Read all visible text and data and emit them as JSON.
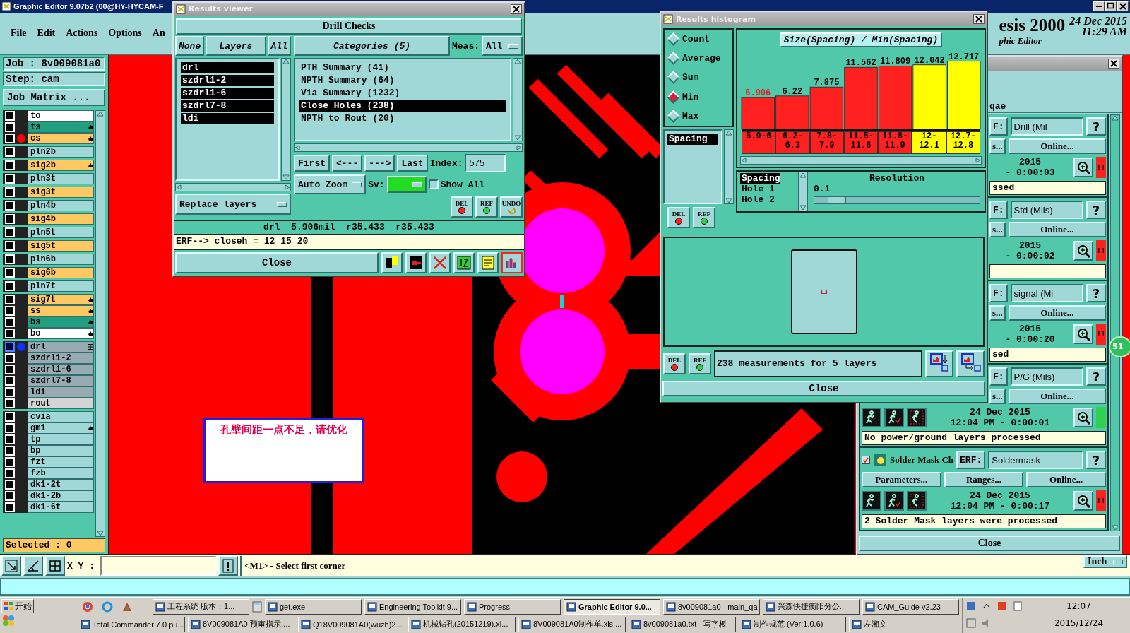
{
  "main_window": {
    "title": "Graphic Editor 9.07b2 (00@HY-HYCAM-F",
    "menu": [
      "File",
      "Edit",
      "Actions",
      "Options",
      "An"
    ]
  },
  "brand": {
    "product": "esis 2000",
    "subtitle": "phic Editor",
    "date": "24 Dec 2015",
    "time": "11:29 AM"
  },
  "layer_panel": {
    "job": "Job : 8v009081a0",
    "step": "Step: cam",
    "job_matrix": "Job Matrix ...",
    "selected": "Selected : 0",
    "groups": [
      {
        "layers": [
          {
            "name": "to",
            "color": "#ffffff",
            "checked": false,
            "displayed": false,
            "work_layer": false,
            "kind": "plain"
          },
          {
            "name": "ts",
            "color": "#20a080",
            "checked": false,
            "displayed": false,
            "work_layer": false,
            "kind": "pointer"
          },
          {
            "name": "cs",
            "color": "#ffc860",
            "checked": false,
            "displayed": true,
            "work_layer": false,
            "kind": "pointer"
          }
        ]
      },
      {
        "layers": [
          {
            "name": "pln2b",
            "color": "#a0d8d8",
            "checked": false,
            "displayed": false,
            "work_layer": false,
            "kind": "plain"
          }
        ]
      },
      {
        "layers": [
          {
            "name": "sig2b",
            "color": "#ffc860",
            "checked": false,
            "displayed": false,
            "work_layer": false,
            "kind": "pointer"
          }
        ]
      },
      {
        "layers": [
          {
            "name": "pln3t",
            "color": "#a0d8d8",
            "checked": false,
            "displayed": false,
            "work_layer": false,
            "kind": "plain"
          }
        ]
      },
      {
        "layers": [
          {
            "name": "sig3t",
            "color": "#ffc860",
            "checked": false,
            "displayed": false,
            "work_layer": false,
            "kind": "plain"
          }
        ]
      },
      {
        "layers": [
          {
            "name": "pln4b",
            "color": "#a0d8d8",
            "checked": false,
            "displayed": false,
            "work_layer": false,
            "kind": "plain"
          }
        ]
      },
      {
        "layers": [
          {
            "name": "sig4b",
            "color": "#ffc860",
            "checked": false,
            "displayed": false,
            "work_layer": false,
            "kind": "plain"
          }
        ]
      },
      {
        "layers": [
          {
            "name": "pln5t",
            "color": "#a0d8d8",
            "checked": false,
            "displayed": false,
            "work_layer": false,
            "kind": "plain"
          }
        ]
      },
      {
        "layers": [
          {
            "name": "sig5t",
            "color": "#ffc860",
            "checked": false,
            "displayed": false,
            "work_layer": false,
            "kind": "plain"
          }
        ]
      },
      {
        "layers": [
          {
            "name": "pln6b",
            "color": "#a0d8d8",
            "checked": false,
            "displayed": false,
            "work_layer": false,
            "kind": "plain"
          }
        ]
      },
      {
        "layers": [
          {
            "name": "sig6b",
            "color": "#ffc860",
            "checked": false,
            "displayed": false,
            "work_layer": false,
            "kind": "plain"
          }
        ]
      },
      {
        "layers": [
          {
            "name": "pln7t",
            "color": "#a0d8d8",
            "checked": false,
            "displayed": false,
            "work_layer": false,
            "kind": "plain"
          }
        ]
      },
      {
        "layers": [
          {
            "name": "sig7t",
            "color": "#ffc860",
            "checked": false,
            "displayed": false,
            "work_layer": false,
            "kind": "pointer"
          },
          {
            "name": "ss",
            "color": "#ffc860",
            "checked": false,
            "displayed": false,
            "work_layer": false,
            "kind": "pointer"
          },
          {
            "name": "bs",
            "color": "#20a080",
            "checked": false,
            "displayed": false,
            "work_layer": false,
            "kind": "pointer"
          },
          {
            "name": "bo",
            "color": "#ffffff",
            "checked": false,
            "displayed": false,
            "work_layer": false,
            "kind": "pointer"
          }
        ]
      },
      {
        "layers": [
          {
            "name": "drl",
            "color": "#98aab2",
            "checked": false,
            "displayed": false,
            "work_layer": true,
            "kind": "grid"
          },
          {
            "name": "szdrl1-2",
            "color": "#98aab2",
            "checked": false,
            "displayed": false,
            "work_layer": false,
            "kind": "plain"
          },
          {
            "name": "szdrl1-6",
            "color": "#98aab2",
            "checked": false,
            "displayed": false,
            "work_layer": false,
            "kind": "plain"
          },
          {
            "name": "szdrl7-8",
            "color": "#98aab2",
            "checked": false,
            "displayed": false,
            "work_layer": false,
            "kind": "plain"
          },
          {
            "name": "ldi",
            "color": "#98aab2",
            "checked": false,
            "displayed": false,
            "work_layer": false,
            "kind": "plain"
          },
          {
            "name": "rout",
            "color": "#d4d4d4",
            "checked": false,
            "displayed": false,
            "work_layer": false,
            "kind": "plain"
          }
        ]
      },
      {
        "layers": [
          {
            "name": "cvia",
            "color": "#a0d8d8",
            "checked": false,
            "displayed": false,
            "work_layer": false,
            "kind": "plain"
          },
          {
            "name": "gm1",
            "color": "#a0d8d8",
            "checked": false,
            "displayed": false,
            "work_layer": false,
            "kind": "pointer"
          },
          {
            "name": "tp",
            "color": "#a0d8d8",
            "checked": false,
            "displayed": false,
            "work_layer": false,
            "kind": "plain"
          },
          {
            "name": "bp",
            "color": "#a0d8d8",
            "checked": false,
            "displayed": false,
            "work_layer": false,
            "kind": "plain"
          },
          {
            "name": "fzt",
            "color": "#a0d8d8",
            "checked": false,
            "displayed": false,
            "work_layer": false,
            "kind": "plain"
          },
          {
            "name": "fzb",
            "color": "#a0d8d8",
            "checked": false,
            "displayed": false,
            "work_layer": false,
            "kind": "plain"
          },
          {
            "name": "dk1-2t",
            "color": "#a0d8d8",
            "checked": false,
            "displayed": false,
            "work_layer": false,
            "kind": "plain"
          },
          {
            "name": "dk1-2b",
            "color": "#a0d8d8",
            "checked": false,
            "displayed": false,
            "work_layer": false,
            "kind": "plain"
          },
          {
            "name": "dk1-6t",
            "color": "#a0d8d8",
            "checked": false,
            "displayed": false,
            "work_layer": false,
            "kind": "plain"
          }
        ]
      }
    ]
  },
  "canvas": {
    "note": "孔壁间距一点不足，请优化"
  },
  "results_viewer": {
    "title": "Results viewer",
    "header": "Drill Checks",
    "layer_tabs": [
      "None",
      "Layers",
      "All"
    ],
    "layers": [
      {
        "name": "drl",
        "selected": true
      },
      {
        "name": "szdrl1-2",
        "selected": true
      },
      {
        "name": "szdrl1-6",
        "selected": true
      },
      {
        "name": "szdrl7-8",
        "selected": true
      },
      {
        "name": "ldi",
        "selected": true
      }
    ],
    "categories_button": "Categories (5)",
    "meas_label": "Meas:",
    "meas_value": "All",
    "categories": [
      {
        "label": "PTH Summary (41)",
        "selected": false
      },
      {
        "label": "NPTH Summary (64)",
        "selected": false
      },
      {
        "label": "Via Summary (1232)",
        "selected": false
      },
      {
        "label": "Close Holes (238)",
        "selected": true
      },
      {
        "label": "NPTH to Rout (20)",
        "selected": false
      }
    ],
    "nav": [
      "First",
      "<---",
      "--->",
      "Last"
    ],
    "index_label": "Index:",
    "index_value": "575",
    "zoom_mode": "Auto Zoom",
    "sv": {
      "label": "Sv:",
      "color": "#22dd22"
    },
    "show_all": {
      "label": "Show All",
      "checked": false
    },
    "replace": "Replace layers",
    "marker_buttons": [
      {
        "kind": "del",
        "label": "DEL"
      },
      {
        "kind": "ref",
        "label": "REF"
      },
      {
        "kind": "undo",
        "label": "UNDO"
      }
    ],
    "info": "drl  5.906mil  r35.433  r35.433",
    "erf": "ERF--> closeh = 12 15 20",
    "close": "Close",
    "tool_buttons": [
      {
        "selected": false
      },
      {
        "selected": false
      },
      {
        "selected": false
      },
      {
        "selected": false
      },
      {
        "selected": false
      },
      {
        "selected": true
      }
    ]
  },
  "histogram": {
    "title": "Results histogram",
    "functions": [
      {
        "label": "Count",
        "selected": false
      },
      {
        "label": "Average",
        "selected": false
      },
      {
        "label": "Sum",
        "selected": false
      },
      {
        "label": "Min",
        "selected": true
      },
      {
        "label": "Max",
        "selected": false
      }
    ],
    "measures": [
      {
        "label": "Spacing",
        "selected": true
      }
    ],
    "marker_buttons": [
      {
        "kind": "del",
        "label": "DEL"
      },
      {
        "kind": "ref",
        "label": "REF"
      }
    ],
    "chart_data": {
      "type": "bar",
      "title": "Size(Spacing) / Min(Spacing)",
      "categories": [
        "5.9-6",
        "6.2-6.3",
        "7.8-7.9",
        "11.5-11.6",
        "11.8-11.9",
        "12-12.1",
        "12.7-12.8"
      ],
      "stacked": true,
      "data_labels": true,
      "series": [
        {
          "color": "#ff2020",
          "values": [
            5.906,
            6.22,
            7.875,
            11.562,
            11.809,
            null,
            null
          ]
        },
        {
          "color": "#ffff00",
          "values": [
            null,
            null,
            null,
            null,
            null,
            12.042,
            12.717
          ]
        }
      ]
    },
    "attributes": [
      {
        "label": "Spacing",
        "selected": true
      },
      {
        "label": "Hole 1",
        "selected": false
      },
      {
        "label": "Hole 2",
        "selected": false
      }
    ],
    "resolution": {
      "label": "Resolution",
      "value": "0.1",
      "level": 0.08
    },
    "bottom_marker_buttons": [
      {
        "kind": "del",
        "label": "DEL"
      },
      {
        "kind": "ref",
        "label": "REF"
      }
    ],
    "summary": "238 measurements for 5 layers",
    "close": "Close"
  },
  "qa_window": {
    "job_field": "qae",
    "badge": "51",
    "close": "Close",
    "blocks": [
      {
        "erf_label": "F:",
        "erf_value": "Drill (Mil",
        "help": "?",
        "buttons": [
          "s...",
          "Online..."
        ],
        "date": "2015",
        "elapsed": "- 0:00:03",
        "status": {
          "kind": "fail",
          "label": "!!"
        },
        "message": "ssed"
      },
      {
        "erf_label": "F:",
        "erf_value": "Std (Mils)",
        "help": "?",
        "buttons": [
          "s...",
          "Online..."
        ],
        "date": "2015",
        "elapsed": "- 0:00:02",
        "status": {
          "kind": "fail",
          "label": "!!"
        }
      },
      {
        "erf_label": "F:",
        "erf_value": "signal (Mi",
        "help": "?",
        "buttons": [
          "s...",
          "Online..."
        ],
        "date": "2015",
        "elapsed": "- 0:00:20",
        "status": {
          "kind": "fail",
          "label": "!!"
        },
        "message": "sed"
      },
      {
        "erf_label": "F:",
        "erf_value": "P/G (Mils)",
        "help": "?",
        "buttons": [
          "s...",
          "Online..."
        ],
        "run_buttons": [
          {
            "kind": "run"
          },
          {
            "kind": "check"
          },
          {
            "kind": "stop"
          }
        ],
        "date": "24 Dec 2015",
        "elapsed": "12:04 PM - 0:00:01",
        "status": {
          "kind": "pass"
        },
        "message": "No power/ground layers processed"
      },
      {
        "checked": true,
        "name": "Solder Mask Ch",
        "erf_label": "ERF:",
        "erf_value": "Soldermask",
        "help": "?",
        "buttons": [
          "Parameters...",
          "Ranges...",
          "Online..."
        ],
        "run_buttons": [
          {
            "kind": "run"
          },
          {
            "kind": "check"
          },
          {
            "kind": "stop"
          }
        ],
        "date": "24 Dec 2015",
        "elapsed": "12:04 PM - 0:00:17",
        "status": {
          "kind": "fail",
          "label": "!!"
        },
        "message": "2 Solder Mask layers were processed"
      }
    ]
  },
  "command_bar": {
    "xy_label": "X Y :",
    "message": "<M1> - Select first corner",
    "units": "Inch"
  },
  "taskbar": {
    "start": "开始",
    "row_1": [
      {
        "label": "工程系统  版本：1...",
        "selected": false
      },
      {
        "label": "get.exe",
        "selected": false
      },
      {
        "label": "Engineering Toolkit 9...",
        "selected": false
      },
      {
        "label": "Progress",
        "selected": false
      },
      {
        "label": "Graphic Editor 9.0...",
        "selected": true
      },
      {
        "label": "8v009081a0 - main_qa",
        "selected": false
      },
      {
        "label": "兴森快捷衡阳分公...",
        "selected": false
      },
      {
        "label": "CAM_Guide v2.23",
        "selected": false
      }
    ],
    "row_2": [
      {
        "label": "Total Commander 7.0 pu...",
        "selected": false
      },
      {
        "label": "8V009081A0-预审指示....",
        "selected": false
      },
      {
        "label": "Q18V009081A0(wuzh)2...",
        "selected": false
      },
      {
        "label": "机械钻孔(20151219).xl...",
        "selected": false
      },
      {
        "label": "8V009081A0制作单.xls ...",
        "selected": false
      },
      {
        "label": "8v009081a0.txt - 写字板",
        "selected": false
      },
      {
        "label": "制作规范 (Ver:1.0.6)",
        "selected": false
      },
      {
        "label": "左湘文",
        "selected": false
      }
    ],
    "clock": "12:07",
    "date": "2015/12/24"
  }
}
